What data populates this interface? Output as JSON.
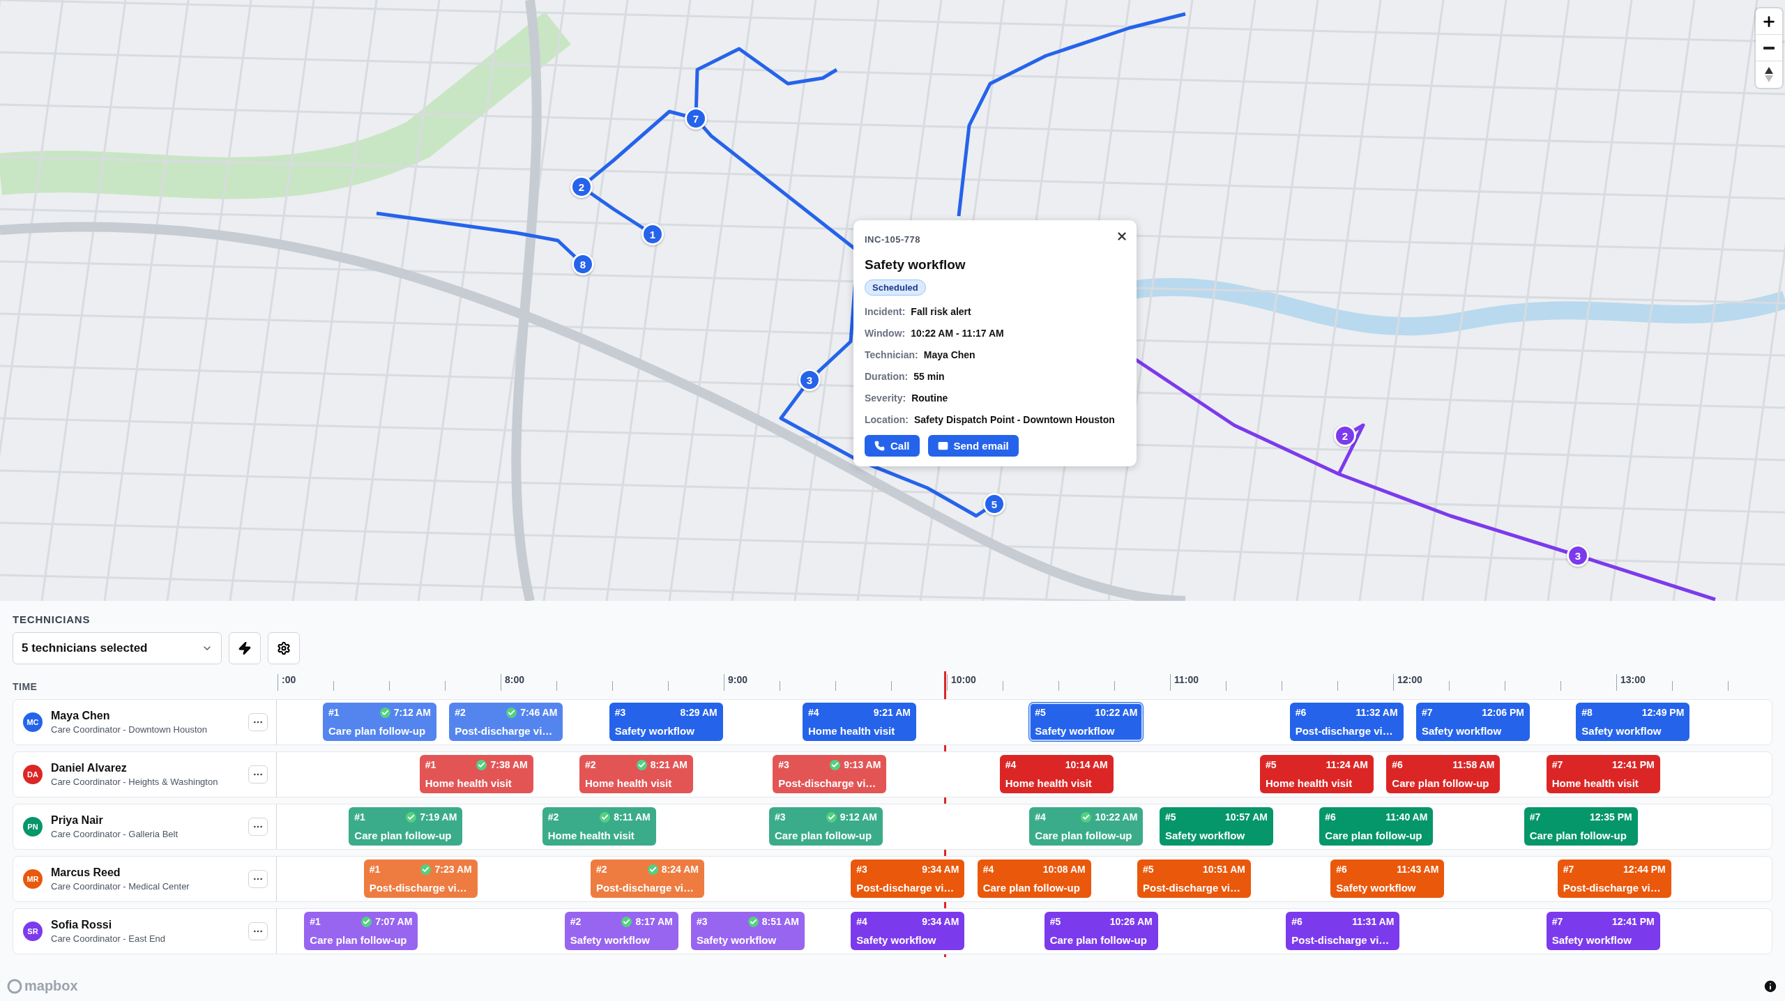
{
  "map": {
    "routes": [
      {
        "color": "#2563eb"
      },
      {
        "color": "#7c3aed"
      }
    ],
    "stops": [
      {
        "label": "7",
        "color": "#2563eb"
      },
      {
        "label": "2",
        "color": "#2563eb"
      },
      {
        "label": "1",
        "color": "#2563eb"
      },
      {
        "label": "8",
        "color": "#2563eb"
      },
      {
        "label": "3",
        "color": "#2563eb"
      },
      {
        "label": "5",
        "color": "#2563eb"
      },
      {
        "label": "2",
        "color": "#7c3aed"
      },
      {
        "label": "3",
        "color": "#7c3aed"
      }
    ],
    "attribution": "mapbox"
  },
  "popup": {
    "id": "INC-105-778",
    "title": "Safety workflow",
    "status": "Scheduled",
    "fields": [
      {
        "label": "Incident:",
        "value": "Fall risk alert"
      },
      {
        "label": "Window:",
        "value": "10:22 AM - 11:17 AM"
      },
      {
        "label": "Technician:",
        "value": "Maya Chen"
      },
      {
        "label": "Duration:",
        "value": "55 min"
      },
      {
        "label": "Severity:",
        "value": "Routine"
      },
      {
        "label": "Location:",
        "value": "Safety Dispatch Point - Downtown Houston"
      }
    ],
    "buttons": [
      {
        "kind": "call",
        "label": "Call"
      },
      {
        "kind": "email",
        "label": "Send email"
      }
    ]
  },
  "panel": {
    "title": "TECHNICIANS",
    "selector": "5 technicians selected",
    "time_label": "TIME",
    "hour_labels": [
      ":00",
      "8:00",
      "9:00",
      "10:00",
      "11:00",
      "12:00",
      "13:00"
    ],
    "technicians": [
      {
        "name": "Maya Chen",
        "role": "Care Coordinator - Downtown Houston",
        "initials": "MC",
        "color": "#2563eb",
        "visits": [
          {
            "number": "#1",
            "time": "7:12 AM",
            "title": "Care plan follow-up",
            "done": true,
            "selected": false
          },
          {
            "number": "#2",
            "time": "7:46 AM",
            "title": "Post-discharge vi…",
            "done": true,
            "selected": false
          },
          {
            "number": "#3",
            "time": "8:29 AM",
            "title": "Safety workflow",
            "done": false,
            "selected": false
          },
          {
            "number": "#4",
            "time": "9:21 AM",
            "title": "Home health visit",
            "done": false,
            "selected": false
          },
          {
            "number": "#5",
            "time": "10:22 AM",
            "title": "Safety workflow",
            "done": false,
            "selected": true
          },
          {
            "number": "#6",
            "time": "11:32 AM",
            "title": "Post-discharge vi…",
            "done": false,
            "selected": false
          },
          {
            "number": "#7",
            "time": "12:06 PM",
            "title": "Safety workflow",
            "done": false,
            "selected": false
          },
          {
            "number": "#8",
            "time": "12:49 PM",
            "title": "Safety workflow",
            "done": false,
            "selected": false
          }
        ]
      },
      {
        "name": "Daniel Alvarez",
        "role": "Care Coordinator - Heights & Washington",
        "initials": "DA",
        "color": "#dc2626",
        "visits": [
          {
            "number": "#1",
            "time": "7:38 AM",
            "title": "Home health visit",
            "done": true,
            "selected": false
          },
          {
            "number": "#2",
            "time": "8:21 AM",
            "title": "Home health visit",
            "done": true,
            "selected": false
          },
          {
            "number": "#3",
            "time": "9:13 AM",
            "title": "Post-discharge vi…",
            "done": true,
            "selected": false
          },
          {
            "number": "#4",
            "time": "10:14 AM",
            "title": "Home health visit",
            "done": false,
            "selected": false
          },
          {
            "number": "#5",
            "time": "11:24 AM",
            "title": "Home health visit",
            "done": false,
            "selected": false
          },
          {
            "number": "#6",
            "time": "11:58 AM",
            "title": "Care plan follow-up",
            "done": false,
            "selected": false
          },
          {
            "number": "#7",
            "time": "12:41 PM",
            "title": "Home health visit",
            "done": false,
            "selected": false
          }
        ]
      },
      {
        "name": "Priya Nair",
        "role": "Care Coordinator - Galleria Belt",
        "initials": "PN",
        "color": "#059669",
        "visits": [
          {
            "number": "#1",
            "time": "7:19 AM",
            "title": "Care plan follow-up",
            "done": true,
            "selected": false
          },
          {
            "number": "#2",
            "time": "8:11 AM",
            "title": "Home health visit",
            "done": true,
            "selected": false
          },
          {
            "number": "#3",
            "time": "9:12 AM",
            "title": "Care plan follow-up",
            "done": true,
            "selected": false
          },
          {
            "number": "#4",
            "time": "10:22 AM",
            "title": "Care plan follow-up",
            "done": true,
            "selected": false
          },
          {
            "number": "#5",
            "time": "10:57 AM",
            "title": "Safety workflow",
            "done": false,
            "selected": false
          },
          {
            "number": "#6",
            "time": "11:40 AM",
            "title": "Care plan follow-up",
            "done": false,
            "selected": false
          },
          {
            "number": "#7",
            "time": "12:35 PM",
            "title": "Care plan follow-up",
            "done": false,
            "selected": false
          }
        ]
      },
      {
        "name": "Marcus Reed",
        "role": "Care Coordinator - Medical Center",
        "initials": "MR",
        "color": "#ea580c",
        "visits": [
          {
            "number": "#1",
            "time": "7:23 AM",
            "title": "Post-discharge vi…",
            "done": true,
            "selected": false
          },
          {
            "number": "#2",
            "time": "8:24 AM",
            "title": "Post-discharge vi…",
            "done": true,
            "selected": false
          },
          {
            "number": "#3",
            "time": "9:34 AM",
            "title": "Post-discharge vi…",
            "done": false,
            "selected": false
          },
          {
            "number": "#4",
            "time": "10:08 AM",
            "title": "Care plan follow-up",
            "done": false,
            "selected": false
          },
          {
            "number": "#5",
            "time": "10:51 AM",
            "title": "Post-discharge vi…",
            "done": false,
            "selected": false
          },
          {
            "number": "#6",
            "time": "11:43 AM",
            "title": "Safety workflow",
            "done": false,
            "selected": false
          },
          {
            "number": "#7",
            "time": "12:44 PM",
            "title": "Post-discharge vi…",
            "done": false,
            "selected": false
          }
        ]
      },
      {
        "name": "Sofia Rossi",
        "role": "Care Coordinator - East End",
        "initials": "SR",
        "color": "#7c3aed",
        "visits": [
          {
            "number": "#1",
            "time": "7:07 AM",
            "title": "Care plan follow-up",
            "done": true,
            "selected": false
          },
          {
            "number": "#2",
            "time": "8:17 AM",
            "title": "Safety workflow",
            "done": true,
            "selected": false
          },
          {
            "number": "#3",
            "time": "8:51 AM",
            "title": "Safety workflow",
            "done": true,
            "selected": false
          },
          {
            "number": "#4",
            "time": "9:34 AM",
            "title": "Safety workflow",
            "done": false,
            "selected": false
          },
          {
            "number": "#5",
            "time": "10:26 AM",
            "title": "Care plan follow-up",
            "done": false,
            "selected": false
          },
          {
            "number": "#6",
            "time": "11:31 AM",
            "title": "Post-discharge vi…",
            "done": false,
            "selected": false
          },
          {
            "number": "#7",
            "time": "12:41 PM",
            "title": "Safety workflow",
            "done": false,
            "selected": false
          }
        ]
      }
    ]
  }
}
